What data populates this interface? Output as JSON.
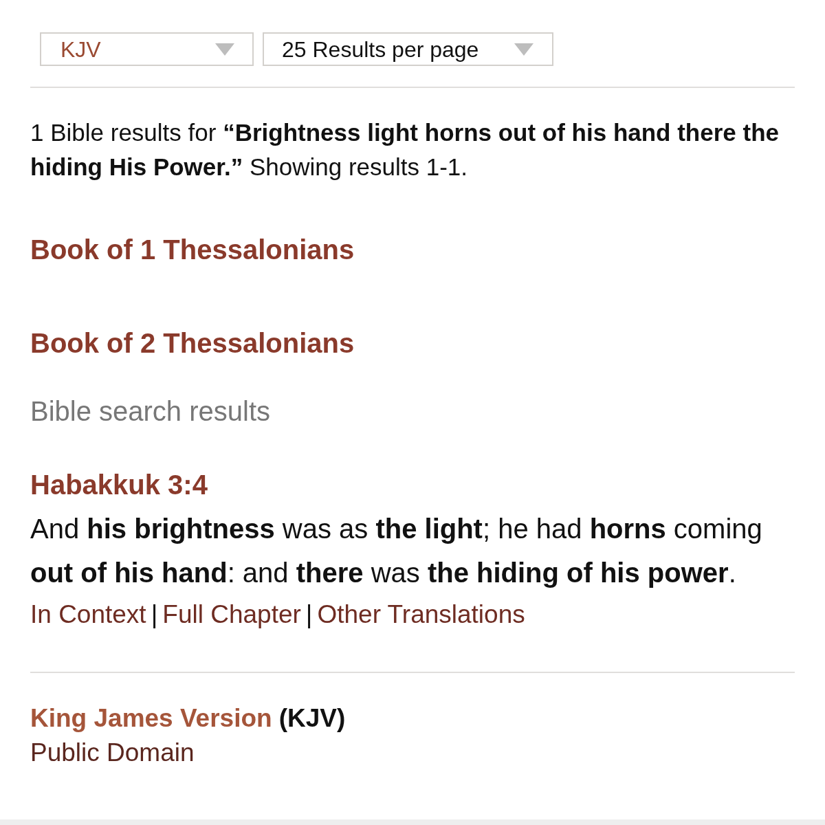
{
  "filters": [
    {
      "kind": "version",
      "value": "KJV"
    },
    {
      "kind": "per_page",
      "value": "25 Results per page"
    }
  ],
  "summary": "1 Bible results for **“Brightness light horns out of his hand there the hiding His Power.”** Showing results 1-1.",
  "book_links": [
    "Book of 1 Thessalonians",
    "Book of 2 Thessalonians"
  ],
  "section_title": "Bible search results",
  "results": [
    {
      "reference": "Habakkuk 3:4",
      "text": "And **his brightness** was as **the light**; he had **horns** coming **out of his hand**: and **there** was **the hiding of his power**.",
      "links": [
        "In Context",
        "Full Chapter",
        "Other Translations"
      ],
      "link_separator": "|"
    }
  ],
  "footer": {
    "version_name": "King James Version",
    "version_abbr": "(KJV)",
    "license": "Public Domain"
  }
}
